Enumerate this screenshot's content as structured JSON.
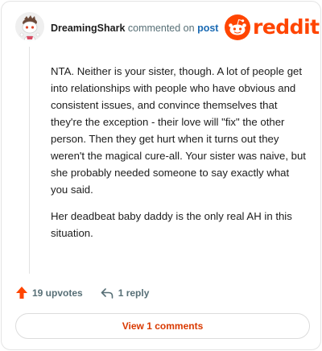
{
  "header": {
    "username": "DreamingShark",
    "commented_on": "commented on",
    "post_link": "post"
  },
  "logo": {
    "wordmark": "reddit",
    "icon": "reddit-alien-icon",
    "brand_color": "#ff4500"
  },
  "comment": {
    "paragraphs": [
      "NTA. Neither is your sister, though. A lot of people get into relationships with people who have obvious and consistent issues, and convince themselves that they're the exception - their love will \"fix\" the other person. Then they get hurt when it turns out they weren't the magical cure-all. Your sister was naive, but she probably needed someone to say exactly what you said.",
      "Her deadbeat baby daddy is the only real AH in this situation."
    ]
  },
  "actions": {
    "upvotes": "19 upvotes",
    "upvote_icon": "upvote-arrow-icon",
    "reply": "1 reply",
    "reply_icon": "reply-arrow-icon",
    "upvote_color": "#ff4500"
  },
  "view_comments_button": "View 1 comments",
  "colors": {
    "link": "#1a6ab3",
    "muted": "#576f76",
    "button_text": "#d93900"
  }
}
